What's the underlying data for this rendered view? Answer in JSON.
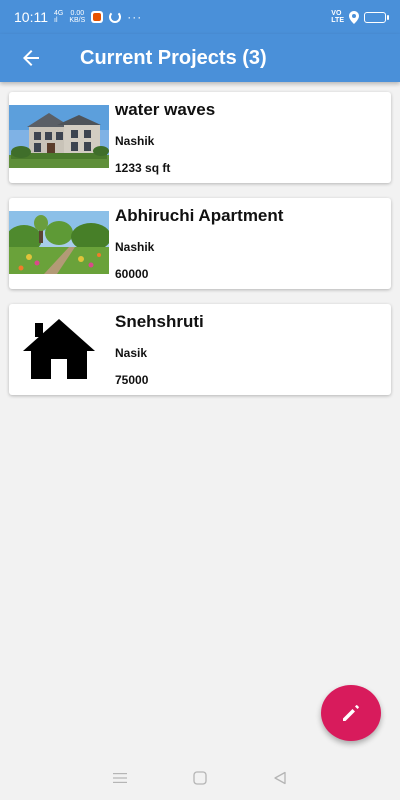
{
  "status_bar": {
    "time": "10:11",
    "network_top": "4G",
    "network_bottom": "ıl",
    "speed_top": "0.00",
    "speed_bottom": "KB/S",
    "more": "···",
    "volte_top": "VO",
    "volte_bottom": "LTE",
    "battery_level": 0.85,
    "battery_color": "#f5d60d"
  },
  "app_bar": {
    "title": "Current Projects (3)",
    "back_icon": "arrow-back-icon",
    "color": "#4a90d9"
  },
  "projects": [
    {
      "name": "water waves",
      "location": "Nashik",
      "size": "1233 sq ft",
      "image": "house-photo"
    },
    {
      "name": "Abhiruchi Apartment",
      "location": "Nashik",
      "size": "60000",
      "image": "garden-photo"
    },
    {
      "name": "Snehshruti",
      "location": "Nasik",
      "size": "75000",
      "image": "home-icon"
    }
  ],
  "fab": {
    "icon": "pencil-icon",
    "color": "#d81b5c"
  },
  "nav_bar": {
    "icons": [
      "menu-icon",
      "home-square-icon",
      "back-triangle-icon"
    ]
  }
}
